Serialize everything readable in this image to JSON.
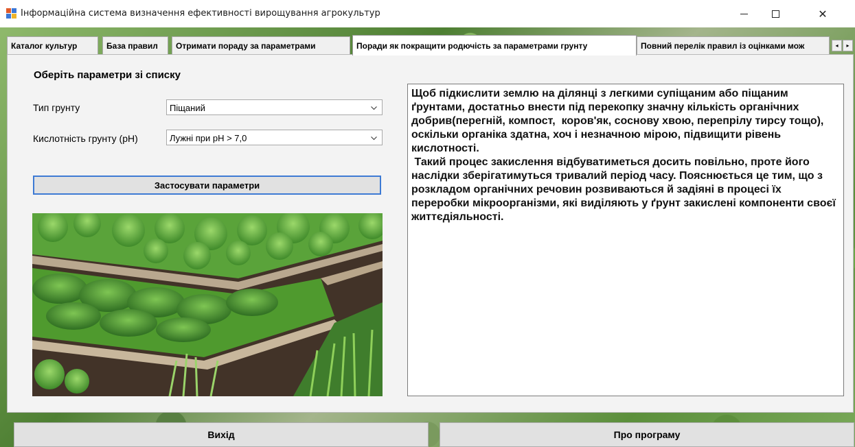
{
  "window": {
    "title": "Інформаційна система визначення ефективності вирощування агрокультур",
    "minimize_icon": "minimize-icon",
    "maximize_icon": "maximize-icon",
    "close_icon": "close-icon",
    "close_glyph": "✕"
  },
  "tabs": [
    {
      "label": "Каталог культур",
      "active": false
    },
    {
      "label": "База правил",
      "active": false
    },
    {
      "label": "Отримати пораду за параметрами",
      "active": false
    },
    {
      "label": "Поради як покращити родючість за параметрами грунту",
      "active": true
    },
    {
      "label": "Повний перелік правил із оцінками мож",
      "active": false
    }
  ],
  "tab_scroll": {
    "left": "◂",
    "right": "▸"
  },
  "form": {
    "section_title": "Оберіть параметри зі списку",
    "soil_type_label": "Тип грунту",
    "soil_type_value": "Піщаний",
    "acidity_label": "Кислотність грунту (pH)",
    "acidity_value": "Лужні при pH > 7,0",
    "apply_button": "Застосувати параметри"
  },
  "photo": {
    "icon": "vegetable-garden-image"
  },
  "advice_text": "Щоб підкислити землю на ділянці з легкими супіщаним або піщаним ґрунтами, достатньо внести під перекопку значну кількість органічних добрив(перегній, компост,  коров'як, соснову хвою, перепрілу тирсу тощо), оскільки органіка здатна, хоч і незначною мірою, підвищити рівень кислотності.\n Такий процес закислення відбуватиметься досить повільно, проте його наслідки зберігатимуться тривалий період часу. Пояснюється це тим, що з розкладом органічних речовин розвиваються й задіяні в процесі їх переробки мікроорганізми, які виділяють у ґрунт закислені компоненти своєї життєдіяльності.",
  "bottom": {
    "exit_button": "Вихід",
    "about_button": "Про програму"
  }
}
